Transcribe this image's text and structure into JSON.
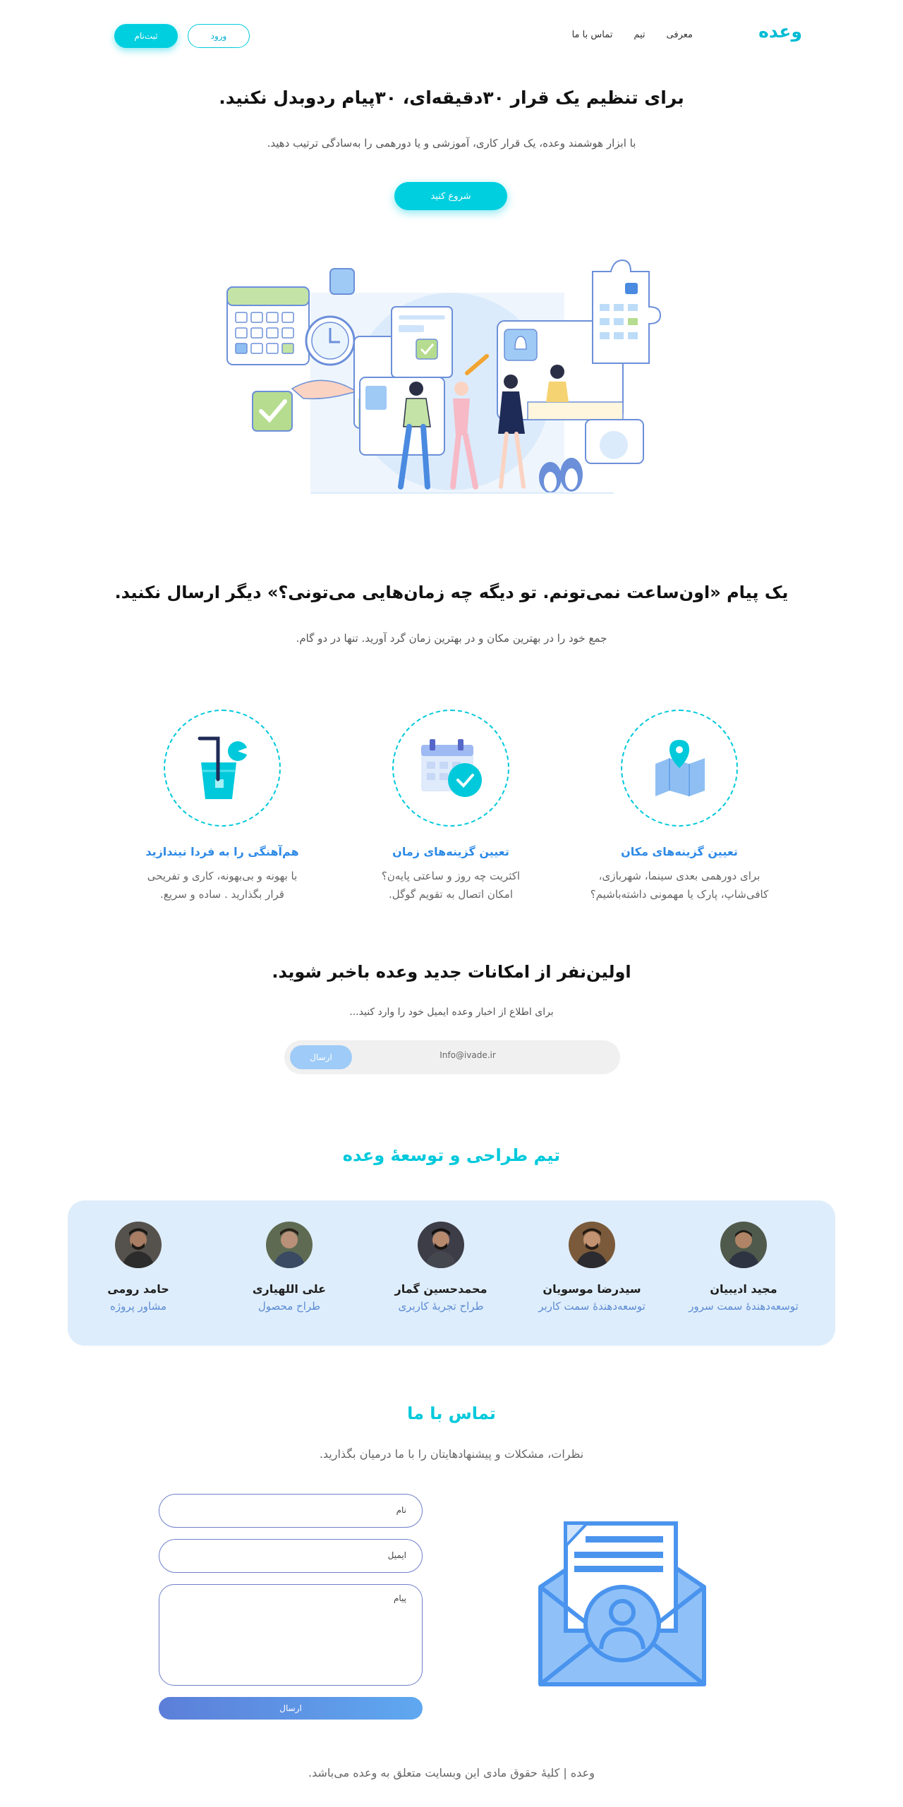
{
  "header": {
    "logo": "وعده",
    "nav": [
      "معرفی",
      "تیم",
      "تماس با ما"
    ],
    "login": "ورود",
    "signup": "ثبت‌نام"
  },
  "hero": {
    "title": "برای تنظیم یک قرار ۳۰دقیقه‌ای، ۳۰پیام ردوبدل نکنید.",
    "subtitle": "با ابزار هوشمند وعده، یک قرار کاری، آموزشی و یا دورهمی را به‌سادگی ترتیب دهید.",
    "cta": "شروع کنید"
  },
  "section2": {
    "title": "یک پیام «اون‌ساعت نمی‌تونم. تو دیگه چه زمان‌هایی می‌تونی؟» دیگر ارسال نکنید.",
    "subtitle": "جمع خود را در بهترین مکان و در بهترین زمان گرد آورید. تنها در دو گام."
  },
  "features": [
    {
      "title": "تعیین گزینه‌های مکان",
      "line1": "برای دورهمی بعدی سینما، شهربازی،",
      "line2": "کافی‌شاپ، پارک یا مهمونی داشته‌باشیم؟",
      "icon": "map-pin-icon"
    },
    {
      "title": "تعیین گزینه‌های زمان",
      "line1": "اکثریت چه روز و ساعتی پایه‌ن؟",
      "line2": "امکان اتصال به تقویم گوگل.",
      "icon": "calendar-check-icon"
    },
    {
      "title": "هم‌آهنگی را به فردا نیندازید",
      "line1": "با بهونه و بی‌بهونه، کاری و تفریحی",
      "line2": "قرار بگذارید . ساده و سریع.",
      "icon": "drink-icon"
    }
  ],
  "newsletter": {
    "title": "اولین‌نفر از امکانات جدید وعده باخبر شوید.",
    "subtitle": "برای اطلاع از اخبار وعده ایمیل خود را وارد کنید...",
    "input_value": "Info@ivade.ir",
    "send": "ارسال"
  },
  "team": {
    "title": "تیم طراحی و توسعهٔ وعده",
    "members": [
      {
        "name": "مجید ادیبیان",
        "role": "توسعه‌دهندهٔ سمت سرور"
      },
      {
        "name": "سیدرضا موسویان",
        "role": "توسعه‌دهندهٔ سمت کاربر"
      },
      {
        "name": "محمدحسین گمار",
        "role": "طراح تجربهٔ کاربری"
      },
      {
        "name": "علی اللهیاری",
        "role": "طراح محصول"
      },
      {
        "name": "حامد رومی",
        "role": "مشاور پروژه"
      }
    ]
  },
  "contact": {
    "title": "تماس با ما",
    "subtitle": "نظرات، مشکلات و پیشنهادهایتان را با ما درمیان بگذارید.",
    "name_placeholder": "نام",
    "email_placeholder": "ایمیل",
    "message_placeholder": "پیام",
    "send": "ارسال"
  },
  "footer": {
    "text": "وعده | کلیهٔ حقوق مادی این وبسایت متعلق به وعده می‌باشد."
  },
  "colors": {
    "accent": "#00cfe0",
    "blue": "#2e8ae6",
    "team_bg": "#deedfb"
  }
}
